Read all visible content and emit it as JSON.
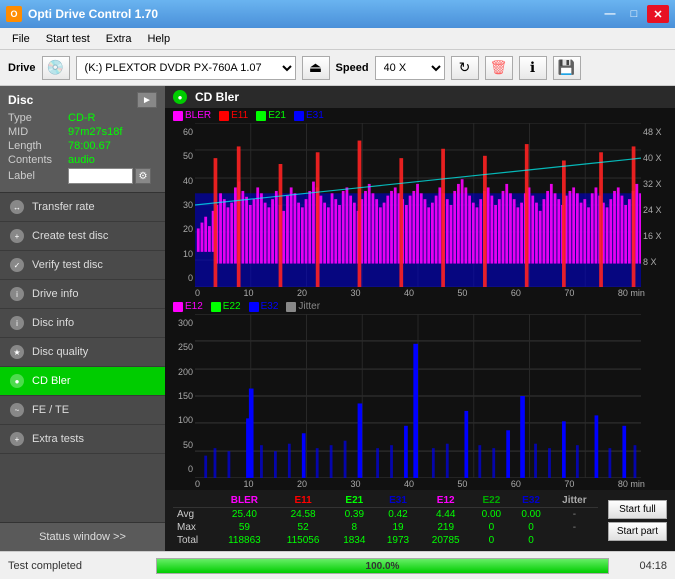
{
  "titleBar": {
    "title": "Opti Drive Control 1.70",
    "iconLabel": "O"
  },
  "menu": {
    "items": [
      "File",
      "Start test",
      "Extra",
      "Help"
    ]
  },
  "toolbar": {
    "driveLabel": "Drive",
    "driveValue": "(K:)  PLEXTOR DVDR  PX-760A 1.07",
    "speedLabel": "Speed",
    "speedValue": "40 X"
  },
  "disc": {
    "title": "Disc",
    "fields": [
      {
        "key": "Type",
        "value": "CD-R"
      },
      {
        "key": "MID",
        "value": "97m27s18f"
      },
      {
        "key": "Length",
        "value": "78:00.67"
      },
      {
        "key": "Contents",
        "value": "audio"
      },
      {
        "key": "Label",
        "value": ""
      }
    ]
  },
  "sidebar": {
    "navItems": [
      {
        "label": "Transfer rate",
        "active": false
      },
      {
        "label": "Create test disc",
        "active": false
      },
      {
        "label": "Verify test disc",
        "active": false
      },
      {
        "label": "Drive info",
        "active": false
      },
      {
        "label": "Disc info",
        "active": false
      },
      {
        "label": "Disc quality",
        "active": false
      },
      {
        "label": "CD Bler",
        "active": true
      },
      {
        "label": "FE / TE",
        "active": false
      },
      {
        "label": "Extra tests",
        "active": false
      }
    ],
    "statusWindowLabel": "Status window >>"
  },
  "chart": {
    "title": "CD Bler",
    "topLegend": [
      {
        "label": "BLER",
        "color": "#ff00ff"
      },
      {
        "label": "E11",
        "color": "#ff0000"
      },
      {
        "label": "E21",
        "color": "#00ff00"
      },
      {
        "label": "E31",
        "color": "#0000ff"
      }
    ],
    "bottomLegend": [
      {
        "label": "E12",
        "color": "#ff00ff"
      },
      {
        "label": "E22",
        "color": "#00ff00"
      },
      {
        "label": "E32",
        "color": "#0000ff"
      },
      {
        "label": "Jitter",
        "color": "#888888"
      }
    ],
    "topYAxis": [
      "60",
      "50",
      "40",
      "30",
      "20",
      "10",
      "0"
    ],
    "bottomYAxis": [
      "300",
      "250",
      "200",
      "150",
      "100",
      "50",
      "0"
    ],
    "topRightAxis": [
      "48 X",
      "40 X",
      "32 X",
      "24 X",
      "16 X",
      "8 X",
      ""
    ],
    "xAxisLabels": [
      "0",
      "10",
      "20",
      "30",
      "40",
      "50",
      "60",
      "70",
      "80 min"
    ]
  },
  "stats": {
    "columns": [
      "BLER",
      "E11",
      "E21",
      "E31",
      "E12",
      "E22",
      "E32",
      "Jitter"
    ],
    "rows": [
      {
        "label": "Avg",
        "values": [
          "25.40",
          "24.58",
          "0.39",
          "0.42",
          "4.44",
          "0.00",
          "0.00",
          "-"
        ]
      },
      {
        "label": "Max",
        "values": [
          "59",
          "52",
          "8",
          "19",
          "219",
          "0",
          "0",
          "-"
        ]
      },
      {
        "label": "Total",
        "values": [
          "118863",
          "115056",
          "1834",
          "1973",
          "20785",
          "0",
          "0",
          ""
        ]
      }
    ],
    "buttons": [
      "Start full",
      "Start part"
    ]
  },
  "statusBar": {
    "text": "Test completed",
    "progress": 100.0,
    "progressText": "100.0%",
    "time": "04:18"
  }
}
